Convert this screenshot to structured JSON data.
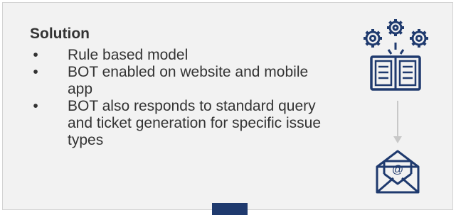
{
  "slide": {
    "heading": "Solution",
    "bullets": [
      {
        "marker": "•",
        "text": "Rule based model"
      },
      {
        "marker": "•",
        "text": "BOT enabled on website and mobile app"
      },
      {
        "marker": "•",
        "text": "BOT also responds to standard query and ticket generation for specific issue types"
      }
    ]
  },
  "icons": {
    "top": "gears-book-icon",
    "bottom": "email-envelope-icon",
    "connector": "arrow-down-icon",
    "email_symbol": "@"
  },
  "colors": {
    "icon": "#1f3a6e",
    "text": "#333333",
    "card_bg": "#f2f2f2",
    "connector": "#c8c8c8"
  }
}
